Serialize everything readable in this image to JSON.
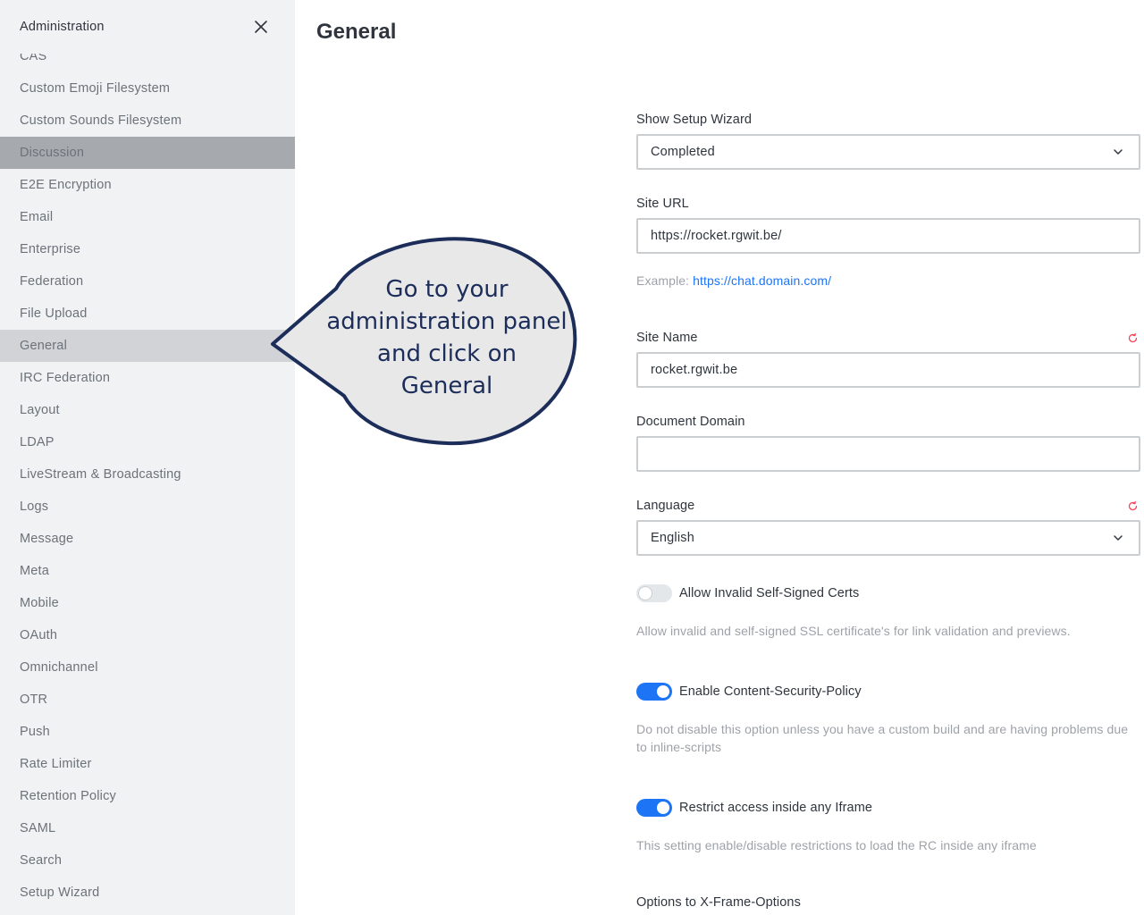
{
  "sidebar": {
    "title": "Administration",
    "items": [
      {
        "label": "CAS"
      },
      {
        "label": "Custom Emoji Filesystem"
      },
      {
        "label": "Custom Sounds Filesystem"
      },
      {
        "label": "Discussion"
      },
      {
        "label": "E2E Encryption"
      },
      {
        "label": "Email"
      },
      {
        "label": "Enterprise"
      },
      {
        "label": "Federation"
      },
      {
        "label": "File Upload"
      },
      {
        "label": "General"
      },
      {
        "label": "IRC Federation"
      },
      {
        "label": "Layout"
      },
      {
        "label": "LDAP"
      },
      {
        "label": "LiveStream & Broadcasting"
      },
      {
        "label": "Logs"
      },
      {
        "label": "Message"
      },
      {
        "label": "Meta"
      },
      {
        "label": "Mobile"
      },
      {
        "label": "OAuth"
      },
      {
        "label": "Omnichannel"
      },
      {
        "label": "OTR"
      },
      {
        "label": "Push"
      },
      {
        "label": "Rate Limiter"
      },
      {
        "label": "Retention Policy"
      },
      {
        "label": "SAML"
      },
      {
        "label": "Search"
      },
      {
        "label": "Setup Wizard"
      }
    ],
    "close_icon": "close-icon"
  },
  "main": {
    "title": "General",
    "show_setup_wizard": {
      "label": "Show Setup Wizard",
      "value": "Completed"
    },
    "site_url": {
      "label": "Site URL",
      "value": "https://rocket.rgwit.be/",
      "hint_prefix": "Example:",
      "hint_link": "https://chat.domain.com/"
    },
    "site_name": {
      "label": "Site Name",
      "value": "rocket.rgwit.be"
    },
    "document_domain": {
      "label": "Document Domain",
      "value": ""
    },
    "language": {
      "label": "Language",
      "value": "English"
    },
    "allow_invalid_certs": {
      "label": "Allow Invalid Self-Signed Certs",
      "enabled": false,
      "hint": "Allow invalid and self-signed SSL certificate's for link validation and previews."
    },
    "enable_csp": {
      "label": "Enable Content-Security-Policy",
      "enabled": true,
      "hint": "Do not disable this option unless you have a custom build and are having problems due to inline-scripts"
    },
    "restrict_iframe": {
      "label": "Restrict access inside any Iframe",
      "enabled": true,
      "hint": "This setting enable/disable restrictions to load the RC inside any iframe"
    },
    "x_frame_options": {
      "label": "Options to X-Frame-Options"
    }
  },
  "callout": {
    "lines": [
      "Go to your",
      "administration panel",
      "and click on",
      "General"
    ]
  },
  "colors": {
    "accent": "#1d74f5",
    "reset_icon": "#f5455c",
    "callout_fill": "#e8e8e9",
    "callout_border": "#1c2d5a"
  }
}
